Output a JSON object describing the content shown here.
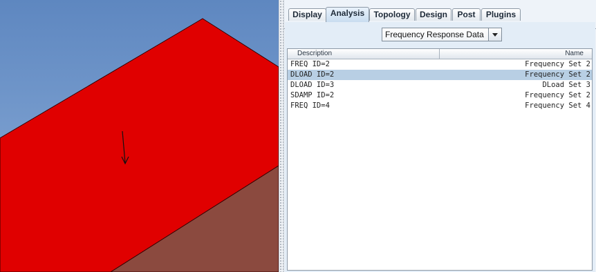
{
  "viewport": {
    "sky_top_color": "#5e87c0",
    "sky_bottom_color": "#8fb0da",
    "plate_color": "#e00000",
    "lower_surface_color": "#8b4a3f",
    "load_arrow_icon": "down-arrow-icon"
  },
  "tabs": [
    {
      "label": "Display",
      "active": false
    },
    {
      "label": "Analysis",
      "active": true
    },
    {
      "label": "Topology",
      "active": false
    },
    {
      "label": "Design",
      "active": false
    },
    {
      "label": "Post",
      "active": false
    },
    {
      "label": "Plugins",
      "active": false
    }
  ],
  "dropdown": {
    "selected": "Frequency Response Data"
  },
  "table": {
    "columns": [
      "Description",
      "Name"
    ],
    "rows": [
      {
        "description": "FREQ ID=2",
        "name": "Frequency Set 2",
        "selected": false
      },
      {
        "description": "DLOAD ID=2",
        "name": "Frequency Set 2",
        "selected": true
      },
      {
        "description": "DLOAD ID=3",
        "name": "DLoad Set 3",
        "selected": false
      },
      {
        "description": "SDAMP ID=2",
        "name": "Frequency Set 2",
        "selected": false
      },
      {
        "description": "FREQ ID=4",
        "name": "Frequency Set 4",
        "selected": false
      }
    ]
  }
}
